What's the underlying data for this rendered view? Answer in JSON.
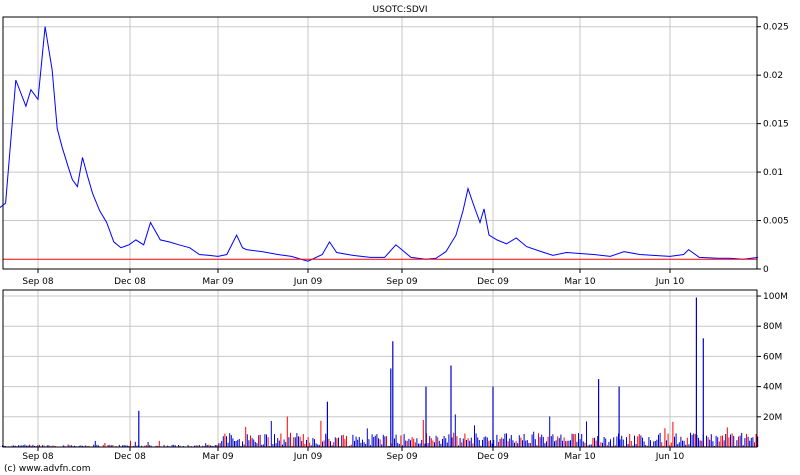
{
  "chart_data": [
    {
      "type": "line",
      "title": "USOTC:SDVI",
      "x_tick_labels": [
        "Sep 08",
        "Dec 08",
        "Mar 09",
        "Jun 09",
        "Sep 09",
        "Dec 09",
        "Mar 10",
        "Jun 10"
      ],
      "x_dates": [
        "2008-07-01",
        "2008-07-15",
        "2008-07-31",
        "2008-08-10",
        "2008-08-20",
        "2008-08-25",
        "2008-09-01",
        "2008-09-08",
        "2008-09-15",
        "2008-09-20",
        "2008-09-25",
        "2008-10-01",
        "2008-10-05",
        "2008-10-10",
        "2008-10-15",
        "2008-10-20",
        "2008-10-25",
        "2008-11-01",
        "2008-11-08",
        "2008-11-15",
        "2008-11-22",
        "2008-11-30",
        "2008-12-07",
        "2008-12-15",
        "2008-12-22",
        "2009-01-01",
        "2009-01-10",
        "2009-01-20",
        "2009-01-31",
        "2009-02-10",
        "2009-02-20",
        "2009-03-01",
        "2009-03-10",
        "2009-03-20",
        "2009-03-26",
        "2009-03-30",
        "2009-04-15",
        "2009-05-01",
        "2009-05-15",
        "2009-06-01",
        "2009-06-15",
        "2009-06-22",
        "2009-06-29",
        "2009-07-15",
        "2009-08-01",
        "2009-08-15",
        "2009-08-26",
        "2009-09-10",
        "2009-09-25",
        "2009-10-05",
        "2009-10-15",
        "2009-10-25",
        "2009-11-01",
        "2009-11-06",
        "2009-11-12",
        "2009-11-18",
        "2009-11-22",
        "2009-11-27",
        "2009-12-05",
        "2009-12-15",
        "2009-12-25",
        "2010-01-05",
        "2010-01-20",
        "2010-02-01",
        "2010-02-15",
        "2010-03-01",
        "2010-03-15",
        "2010-04-01",
        "2010-04-15",
        "2010-05-01",
        "2010-05-15",
        "2010-06-01",
        "2010-06-15",
        "2010-06-20",
        "2010-07-01",
        "2010-07-20",
        "2010-08-01",
        "2010-08-15",
        "2010-08-30"
      ],
      "price": [
        0.0063,
        0.0055,
        0.0068,
        0.0195,
        0.0168,
        0.0185,
        0.0175,
        0.025,
        0.0205,
        0.0145,
        0.0125,
        0.0105,
        0.0092,
        0.0085,
        0.0115,
        0.0096,
        0.0078,
        0.006,
        0.0048,
        0.0028,
        0.0022,
        0.0025,
        0.003,
        0.0025,
        0.0048,
        0.003,
        0.0028,
        0.0025,
        0.0022,
        0.0015,
        0.0014,
        0.0013,
        0.0015,
        0.0035,
        0.0022,
        0.002,
        0.0018,
        0.0015,
        0.0013,
        0.0008,
        0.0015,
        0.0028,
        0.0017,
        0.0014,
        0.0012,
        0.0012,
        0.0025,
        0.0012,
        0.001,
        0.0011,
        0.0018,
        0.0035,
        0.006,
        0.0083,
        0.0065,
        0.0048,
        0.0062,
        0.0035,
        0.003,
        0.0026,
        0.0032,
        0.0023,
        0.0018,
        0.0014,
        0.0017,
        0.0016,
        0.0015,
        0.0013,
        0.0018,
        0.0015,
        0.0014,
        0.0013,
        0.0015,
        0.002,
        0.0012,
        0.0011,
        0.0011,
        0.001,
        0.0012
      ],
      "reference_line": 0.001,
      "ylim": [
        0,
        0.026
      ],
      "y_ticks": [
        0,
        0.005,
        0.01,
        0.015,
        0.02,
        0.025
      ],
      "y_tick_labels": [
        "0",
        "0.005",
        "0.01",
        "0.015",
        "0.02",
        "0.025"
      ],
      "line_color": "#0000ff",
      "reference_color": "#ff0000",
      "grid": true
    },
    {
      "type": "bar",
      "title": "",
      "x_tick_labels": [
        "Sep 08",
        "Dec 08",
        "Mar 09",
        "Jun 09",
        "Sep 09",
        "Dec 09",
        "Mar 10",
        "Jun 10"
      ],
      "volume_spikes": [
        {
          "date": "2008-12-10",
          "value": 24000000
        },
        {
          "date": "2009-06-20",
          "value": 30000000
        },
        {
          "date": "2009-08-21",
          "value": 52000000
        },
        {
          "date": "2009-08-23",
          "value": 70000000
        },
        {
          "date": "2009-09-25",
          "value": 40000000
        },
        {
          "date": "2009-10-20",
          "value": 54000000
        },
        {
          "date": "2009-12-01",
          "value": 40000000
        },
        {
          "date": "2010-03-20",
          "value": 45000000
        },
        {
          "date": "2010-04-10",
          "value": 40000000
        },
        {
          "date": "2010-06-28",
          "value": 99000000
        },
        {
          "date": "2010-07-05",
          "value": 72000000
        }
      ],
      "ylim": [
        0,
        104000000
      ],
      "y_ticks": [
        20000000,
        40000000,
        60000000,
        80000000,
        100000000
      ],
      "y_tick_labels": [
        "20M",
        "40M",
        "60M",
        "80M",
        "100M"
      ],
      "up_color": "#0000cc",
      "down_color": "#ff0000",
      "grid": true
    }
  ],
  "copyright": "(c) www.advfn.com"
}
